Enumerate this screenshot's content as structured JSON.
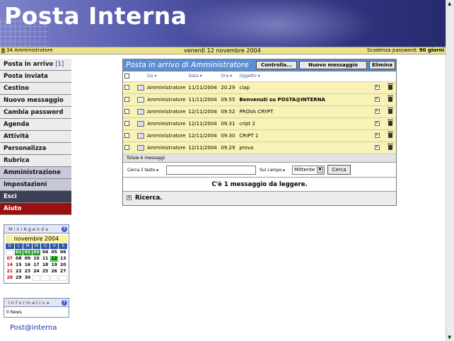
{
  "header": {
    "title": "Posta Interna"
  },
  "infobar": {
    "user": "34 Amministratore",
    "date": "venerdì 12 novembre 2004",
    "password_label": "Scadenza password:",
    "password_value": "90 giorni"
  },
  "sidebar": {
    "items": [
      {
        "label": "Posta in arrivo",
        "count": "[1]"
      },
      {
        "label": "Posta inviata"
      },
      {
        "label": "Cestino"
      },
      {
        "label": "Nuovo messaggio"
      },
      {
        "label": "Cambia password"
      },
      {
        "label": "Agenda"
      },
      {
        "label": "Attività"
      },
      {
        "label": "Personalizza"
      },
      {
        "label": "Rubrica"
      },
      {
        "label": "Amministrazione"
      },
      {
        "label": "Impostazioni"
      },
      {
        "label": "Esci"
      },
      {
        "label": "Aiuto"
      }
    ]
  },
  "miniagenda": {
    "title": "MiniAgenda",
    "month": "novembre 2004",
    "day_headers": [
      "D",
      "L",
      "M",
      "M",
      "G",
      "V",
      "S"
    ],
    "weeks": [
      [
        "",
        "01",
        "02",
        "03",
        "04",
        "05",
        "06"
      ],
      [
        "07",
        "08",
        "09",
        "10",
        "11",
        "12",
        "13"
      ],
      [
        "14",
        "15",
        "16",
        "17",
        "18",
        "19",
        "20"
      ],
      [
        "21",
        "22",
        "23",
        "24",
        "25",
        "26",
        "27"
      ],
      [
        "28",
        "29",
        "30",
        "",
        "",
        "",
        ""
      ]
    ],
    "today": "12",
    "highlighted": [
      "01",
      "02",
      "03"
    ]
  },
  "informativa": {
    "title": "Informativa",
    "news": "0 News"
  },
  "logo": {
    "text": "Post@interna"
  },
  "panel": {
    "title": "Posta in arrivo di Amministratore",
    "buttons": {
      "check": "Controlla...",
      "new": "Nuovo messaggio",
      "delete": "Elimina"
    },
    "columns": {
      "from": "Da",
      "date": "Data",
      "time": "Ora",
      "subject": "Oggetto"
    },
    "messages": [
      {
        "from": "Amministratore",
        "date": "11/11/2004",
        "time": "20.29",
        "subject": "ciap",
        "unread": false
      },
      {
        "from": "Amministratore",
        "date": "11/11/2004",
        "time": "09.55",
        "subject": "Benvenuti su POSTA@INTERNA",
        "unread": true
      },
      {
        "from": "Amministratore",
        "date": "12/11/2004",
        "time": "09.52",
        "subject": "PROVA CRYPT",
        "unread": false
      },
      {
        "from": "Amministratore",
        "date": "12/11/2004",
        "time": "09.31",
        "subject": "cript 2",
        "unread": false
      },
      {
        "from": "Amministratore",
        "date": "12/11/2004",
        "time": "09.30",
        "subject": "CRIPT 1",
        "unread": false
      },
      {
        "from": "Amministratore",
        "date": "12/11/2004",
        "time": "09.29",
        "subject": "prova",
        "unread": false
      }
    ],
    "total": "Totale 6 messaggi",
    "search": {
      "text_label": "Cerca il testo",
      "field_label": "Sul campo",
      "field_value": "Mittente",
      "button": "Cerca"
    },
    "notice": "C'è 1 messaggio da leggere.",
    "ricerca": "Ricerca."
  }
}
